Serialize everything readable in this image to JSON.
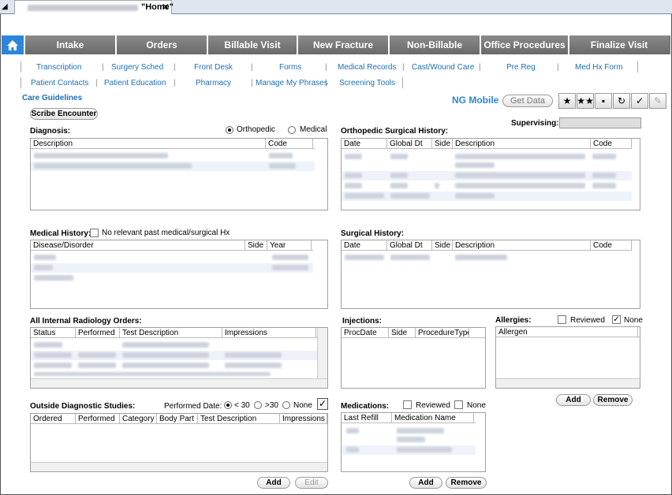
{
  "tab": {
    "title": "\"Home\"",
    "close": "✕"
  },
  "nav": {
    "home_icon": "home-icon",
    "items": [
      "Intake",
      "Orders",
      "Billable Visit",
      "New Fracture",
      "Non-Billable",
      "Office Procedures",
      "Finalize Visit"
    ]
  },
  "links_row1": [
    "Transcription",
    "Surgery Sched",
    "Front Desk",
    "Forms",
    "Medical Records",
    "Cast/Wound Care",
    "Pre Reg",
    "Med Hx Form"
  ],
  "links_row2": [
    "Patient Contacts",
    "Patient Education",
    "Pharmacy",
    "Manage My Phrases",
    "Screening Tools"
  ],
  "care_guidelines": "Care Guidelines",
  "scribe": "Scribe Encounter",
  "ng_mobile": "NG Mobile",
  "get_data": "Get Data",
  "supervising": "Supervising:",
  "diagnosis": {
    "label": "Diagnosis:",
    "opt1": "Orthopedic",
    "opt2": "Medical",
    "cols": [
      "Description",
      "Code"
    ]
  },
  "ortho_surg": {
    "label": "Orthopedic Surgical History:",
    "cols": [
      "Date",
      "Global Dt",
      "Side",
      "Description",
      "Code"
    ]
  },
  "medical_history": {
    "label": "Medical History:",
    "none": "No relevant past medical/surgical Hx",
    "cols": [
      "Disease/Disorder",
      "Side",
      "Year"
    ]
  },
  "surgical_history": {
    "label": "Surgical History:",
    "cols": [
      "Date",
      "Global Dt",
      "Side",
      "Description",
      "Code"
    ]
  },
  "radiology": {
    "label": "All Internal Radiology Orders:",
    "cols": [
      "Status",
      "Performed",
      "Test Description",
      "Impressions"
    ]
  },
  "injections": {
    "label": "Injections:",
    "cols": [
      "ProcDate",
      "Side",
      "ProcedureType"
    ]
  },
  "allergies": {
    "label": "Allergies:",
    "reviewed": "Reviewed",
    "none": "None",
    "cols": [
      "Allergen"
    ],
    "add": "Add",
    "remove": "Remove"
  },
  "outside": {
    "label": "Outside Diagnostic Studies:",
    "performed": "Performed Date:",
    "lt30": "< 30",
    "gt30": ">30",
    "none": "None",
    "cols": [
      "Ordered",
      "Performed",
      "Category",
      "Body Part",
      "Test Description",
      "Impressions"
    ],
    "add": "Add",
    "edit": "Edit"
  },
  "medications": {
    "label": "Medications:",
    "reviewed": "Reviewed",
    "none": "None",
    "cols": [
      "Last Refill",
      "Medication Name"
    ],
    "add": "Add",
    "remove": "Remove"
  }
}
